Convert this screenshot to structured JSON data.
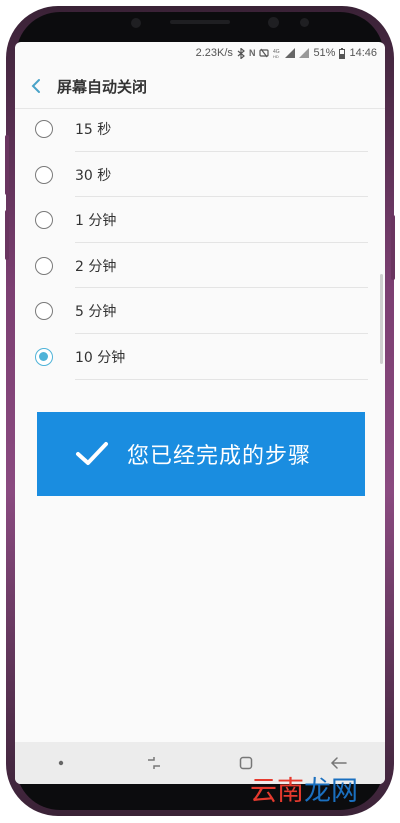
{
  "status_bar": {
    "speed": "2.23K/s",
    "battery": "51%",
    "time": "14:46",
    "icons": [
      "bluetooth-icon",
      "nfc-icon",
      "mute-icon",
      "volte-icon",
      "signal-icon",
      "signal-icon",
      "battery-icon"
    ]
  },
  "header": {
    "back_icon": "chevron-left-icon",
    "title": "屏幕自动关闭"
  },
  "options": [
    {
      "label": "15 秒",
      "selected": false
    },
    {
      "label": "30 秒",
      "selected": false
    },
    {
      "label": "1 分钟",
      "selected": false
    },
    {
      "label": "2 分钟",
      "selected": false
    },
    {
      "label": "5 分钟",
      "selected": false
    },
    {
      "label": "10 分钟",
      "selected": true
    }
  ],
  "banner": {
    "icon": "checkmark-icon",
    "text": "您已经完成的步骤"
  },
  "navbar": {
    "items": [
      "dot-icon",
      "recent-apps-icon",
      "home-icon",
      "back-arrow-icon"
    ]
  },
  "watermark": {
    "text": "云南龙网",
    "colors": [
      "#e63a2e",
      "#e63a2e",
      "#1a6fbf",
      "#1a6fbf"
    ]
  },
  "colors": {
    "accent": "#4fb3d8",
    "banner": "#1a8de0",
    "phone_frame": "#8a4a80"
  }
}
